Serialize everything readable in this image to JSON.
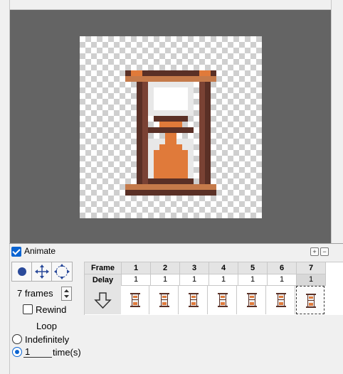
{
  "animate": {
    "label": "Animate",
    "checked": true
  },
  "frames_count": {
    "value": "7",
    "label": "frames"
  },
  "rewind": {
    "label": "Rewind",
    "checked": false
  },
  "loop": {
    "title": "Loop",
    "indefinitely_label": "Indefinitely",
    "times_value": "1",
    "times_label": "time(s)",
    "selected": "times"
  },
  "table": {
    "frame_header": "Frame",
    "delay_header": "Delay",
    "frames": [
      "1",
      "2",
      "3",
      "4",
      "5",
      "6",
      "7"
    ],
    "delays": [
      "1",
      "1",
      "1",
      "1",
      "1",
      "1",
      "1"
    ],
    "selected_frame": "7"
  },
  "icons": {
    "move_down": "arrow-down-icon",
    "zoom_in": "plus-icon",
    "zoom_out": "minus-icon"
  },
  "colors": {
    "accent": "#0a64d2",
    "preview_bg": "#646464",
    "hourglass_frame": "#5a3026",
    "hourglass_sand": "#e07a3a"
  }
}
